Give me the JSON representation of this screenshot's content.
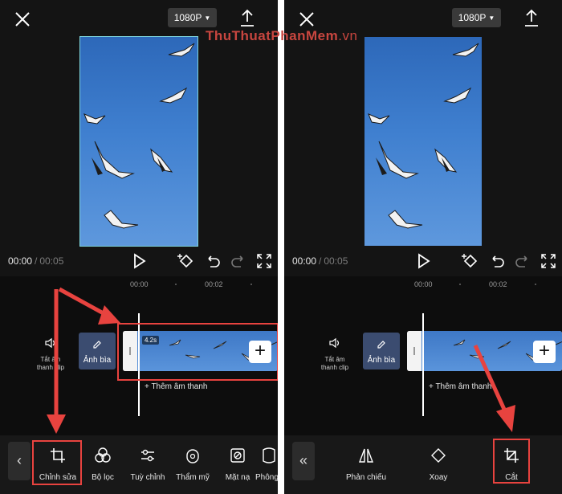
{
  "watermark": {
    "name": "ThuThuatPhanMem",
    "suffix": ".vn"
  },
  "accent_red": "#e8433f",
  "left": {
    "resolution": "1080P",
    "time_current": "00:00",
    "time_total": "00:05",
    "ruler": [
      "00:00",
      "00:02"
    ],
    "mute_label_1": "Tắt âm",
    "mute_label_2": "thanh clip",
    "cover_label": "Ảnh bìa",
    "clip_duration": "4.2s",
    "add_audio": "+ Thêm âm thanh",
    "tools": [
      "Chỉnh sửa",
      "Bộ lọc",
      "Tuỳ chỉnh",
      "Thẩm mỹ",
      "Mặt nạ",
      "Phông"
    ]
  },
  "right": {
    "resolution": "1080P",
    "time_current": "00:00",
    "time_total": "00:05",
    "ruler": [
      "00:00",
      "00:02"
    ],
    "mute_label_1": "Tắt âm",
    "mute_label_2": "thanh clip",
    "cover_label": "Ảnh bìa",
    "add_audio": "+ Thêm âm thanh",
    "tools": [
      "Phản chiếu",
      "Xoay",
      "Cắt"
    ]
  }
}
